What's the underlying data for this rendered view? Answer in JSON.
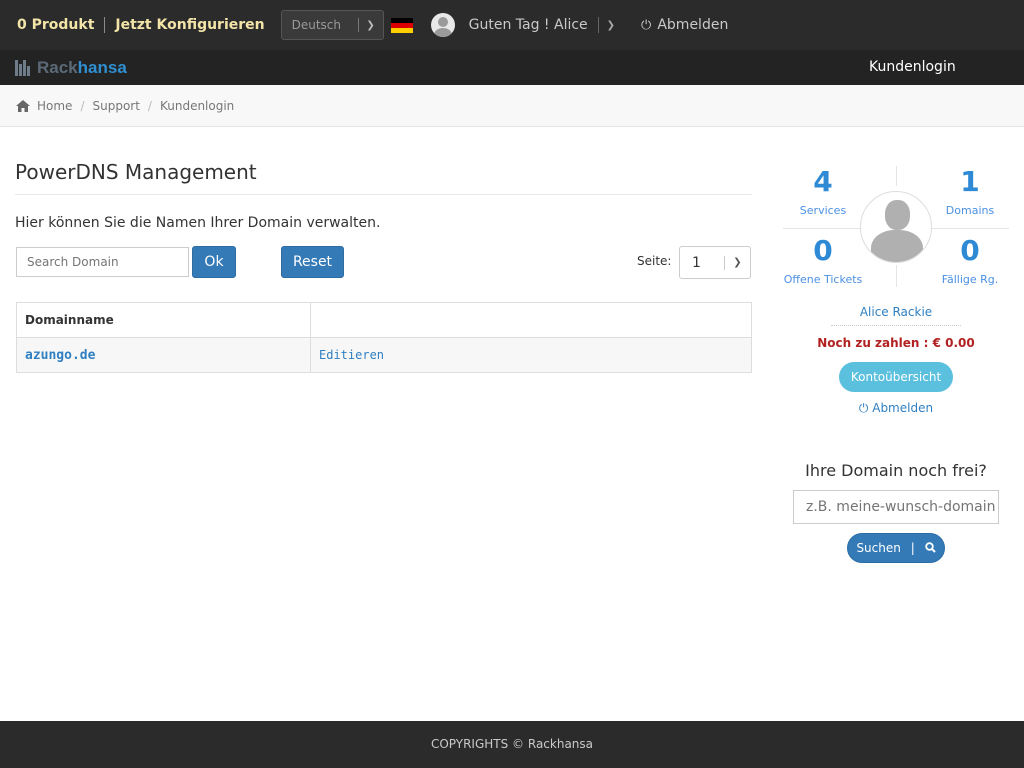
{
  "topbar": {
    "cart": "0 Produkt",
    "configure": "Jetzt Konfigurieren",
    "language": "Deutsch",
    "greeting": "Guten Tag ! Alice",
    "logout": "Abmelden",
    "flag_colors": [
      "#000000",
      "#dd0000",
      "#ffce00"
    ]
  },
  "brand": {
    "rack": "Rack",
    "hansa": "hansa",
    "nav_login": "Kundenlogin"
  },
  "breadcrumb": {
    "home": "Home",
    "support": "Support",
    "current": "Kundenlogin"
  },
  "main": {
    "title": "PowerDNS Management",
    "intro": "Hier können Sie die Namen Ihrer Domain verwalten.",
    "search_placeholder": "Search Domain",
    "ok": "Ok",
    "reset": "Reset",
    "page_label": "Seite:",
    "page_value": "1",
    "table": {
      "headers": [
        "Domainname",
        ""
      ],
      "rows": [
        {
          "domain": "azungo.de",
          "action": "Editieren"
        }
      ]
    }
  },
  "sidebar": {
    "services_count": "4",
    "services_label": "Services",
    "domains_count": "1",
    "domains_label": "Domains",
    "tickets_count": "0",
    "tickets_label": "Offene Tickets",
    "rg_count": "0",
    "rg_label": "Fällige Rg.",
    "user_name": "Alice Rackie",
    "due": "Noch zu zahlen : € 0.00",
    "konto_button": "Kontoübersicht",
    "logout": "Abmelden",
    "domain_title": "Ihre Domain noch frei?",
    "domain_placeholder": "z.B. meine-wunsch-domain",
    "search_button": "Suchen"
  },
  "footer": {
    "copyright": "COPYRIGHTS © Rackhansa"
  },
  "colors": {
    "accent": "#337ab7",
    "info": "#5bc0de",
    "dark": "#2b2b2b",
    "due": "#b22222"
  }
}
